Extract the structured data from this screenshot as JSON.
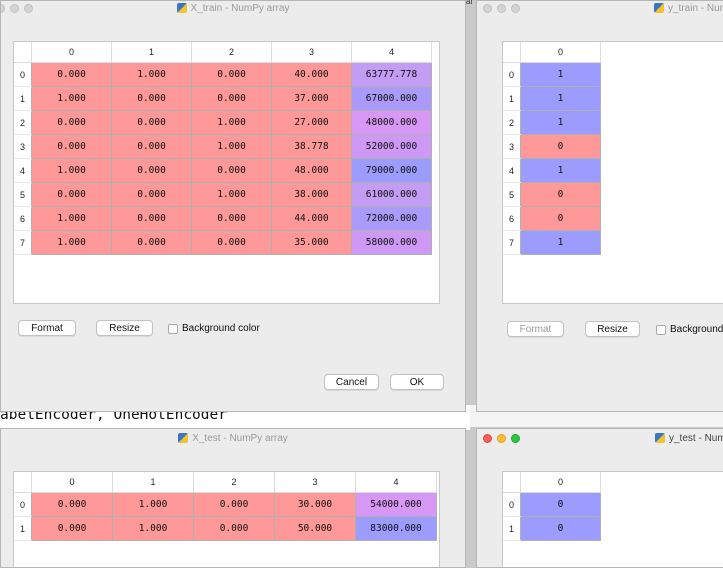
{
  "background": {
    "code_text": "abelEncoder, OneHotEncoder",
    "menu_fragment": "ai"
  },
  "colors": {
    "red": "#ff9999",
    "blue": "#9c9cff",
    "violet": "#d698f4",
    "violet2": "#cd99f5",
    "violet3": "#c39cf4",
    "blue2": "#aa9af9"
  },
  "x_train": {
    "title": "X_train - NumPy array",
    "columns": [
      "0",
      "1",
      "2",
      "3",
      "4"
    ],
    "rows": [
      {
        "index": "0",
        "cells": [
          "0.000",
          "1.000",
          "0.000",
          "40.000",
          "63777.778"
        ],
        "colors": [
          "red",
          "red",
          "red",
          "red",
          "violet3"
        ]
      },
      {
        "index": "1",
        "cells": [
          "1.000",
          "0.000",
          "0.000",
          "37.000",
          "67000.000"
        ],
        "colors": [
          "red",
          "red",
          "red",
          "red",
          "blue2"
        ]
      },
      {
        "index": "2",
        "cells": [
          "0.000",
          "0.000",
          "1.000",
          "27.000",
          "48000.000"
        ],
        "colors": [
          "red",
          "red",
          "red",
          "red",
          "violet"
        ]
      },
      {
        "index": "3",
        "cells": [
          "0.000",
          "0.000",
          "1.000",
          "38.778",
          "52000.000"
        ],
        "colors": [
          "red",
          "red",
          "red",
          "red",
          "violet2"
        ]
      },
      {
        "index": "4",
        "cells": [
          "1.000",
          "0.000",
          "0.000",
          "48.000",
          "79000.000"
        ],
        "colors": [
          "red",
          "red",
          "red",
          "red",
          "blue"
        ]
      },
      {
        "index": "5",
        "cells": [
          "0.000",
          "0.000",
          "1.000",
          "38.000",
          "61000.000"
        ],
        "colors": [
          "red",
          "red",
          "red",
          "red",
          "violet3"
        ]
      },
      {
        "index": "6",
        "cells": [
          "1.000",
          "0.000",
          "0.000",
          "44.000",
          "72000.000"
        ],
        "colors": [
          "red",
          "red",
          "red",
          "red",
          "blue2"
        ]
      },
      {
        "index": "7",
        "cells": [
          "1.000",
          "0.000",
          "0.000",
          "35.000",
          "58000.000"
        ],
        "colors": [
          "red",
          "red",
          "red",
          "red",
          "violet2"
        ]
      }
    ],
    "format_label": "Format",
    "resize_label": "Resize",
    "bgcolor_label": "Background color",
    "cancel_label": "Cancel",
    "ok_label": "OK"
  },
  "y_train": {
    "title": "y_train - NumPy array",
    "columns": [
      "0"
    ],
    "rows": [
      {
        "index": "0",
        "cells": [
          "1"
        ],
        "colors": [
          "blue"
        ]
      },
      {
        "index": "1",
        "cells": [
          "1"
        ],
        "colors": [
          "blue"
        ]
      },
      {
        "index": "2",
        "cells": [
          "1"
        ],
        "colors": [
          "blue"
        ]
      },
      {
        "index": "3",
        "cells": [
          "0"
        ],
        "colors": [
          "red"
        ]
      },
      {
        "index": "4",
        "cells": [
          "1"
        ],
        "colors": [
          "blue"
        ]
      },
      {
        "index": "5",
        "cells": [
          "0"
        ],
        "colors": [
          "red"
        ]
      },
      {
        "index": "6",
        "cells": [
          "0"
        ],
        "colors": [
          "red"
        ]
      },
      {
        "index": "7",
        "cells": [
          "1"
        ],
        "colors": [
          "blue"
        ]
      }
    ],
    "format_label": "Format",
    "resize_label": "Resize",
    "bgcolor_label": "Background color"
  },
  "x_test": {
    "title": "X_test - NumPy array",
    "columns": [
      "0",
      "1",
      "2",
      "3",
      "4"
    ],
    "rows": [
      {
        "index": "0",
        "cells": [
          "0.000",
          "1.000",
          "0.000",
          "30.000",
          "54000.000"
        ],
        "colors": [
          "red",
          "red",
          "red",
          "red",
          "violet"
        ]
      },
      {
        "index": "1",
        "cells": [
          "0.000",
          "1.000",
          "0.000",
          "50.000",
          "83000.000"
        ],
        "colors": [
          "red",
          "red",
          "red",
          "red",
          "blue"
        ]
      }
    ]
  },
  "y_test": {
    "title": "y_test - NumPy array",
    "columns": [
      "0"
    ],
    "rows": [
      {
        "index": "0",
        "cells": [
          "0"
        ],
        "colors": [
          "blue"
        ]
      },
      {
        "index": "1",
        "cells": [
          "0"
        ],
        "colors": [
          "blue"
        ]
      }
    ]
  }
}
